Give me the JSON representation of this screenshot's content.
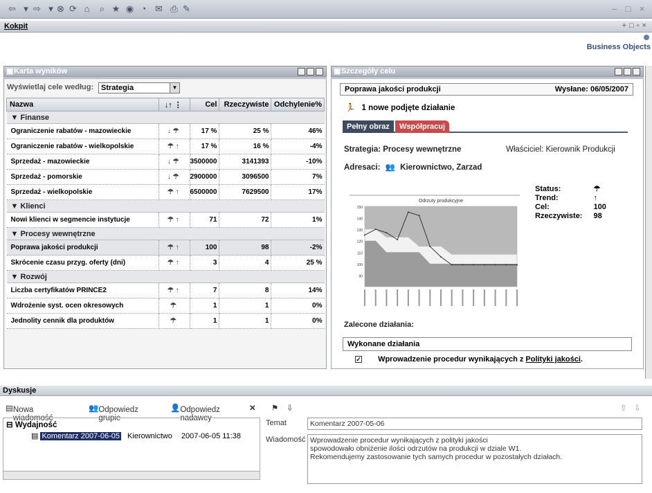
{
  "kokpit": {
    "title": "Kokpit"
  },
  "logo": {
    "text": "Business Objects"
  },
  "left_panel": {
    "title": "Karta wyników",
    "filter_label": "Wyświetlaj cele według:",
    "filter_value": "Strategia",
    "columns": {
      "name": "Nazwa",
      "cel": "Cel",
      "rzecz": "Rzeczywiste",
      "odch": "Odchylenie%"
    },
    "groups": [
      {
        "name": "Finanse",
        "rows": [
          {
            "name": "Ograniczenie rabatów - mazowieckie",
            "icons": "↓ ☂",
            "cel": "17 %",
            "rzecz": "25 %",
            "odch": "46%"
          },
          {
            "name": "Ograniczenie rabatów - wielkopolskie",
            "icons": "☂ ↑",
            "cel": "17 %",
            "rzecz": "16 %",
            "odch": "-4%"
          },
          {
            "name": "Sprzedaż - mazowieckie",
            "icons": "↓ ☂",
            "cel": "3500000",
            "rzecz": "3141393",
            "odch": "-10%"
          },
          {
            "name": "Sprzedaż - pomorskie",
            "icons": "↓ ☂",
            "cel": "2900000",
            "rzecz": "3096500",
            "odch": "7%"
          },
          {
            "name": "Sprzedaż - wielkopolskie",
            "icons": "☂ ↑",
            "cel": "6500000",
            "rzecz": "7629500",
            "odch": "17%"
          }
        ]
      },
      {
        "name": "Klienci",
        "rows": [
          {
            "name": "Nowi klienci w segmencie instytucje",
            "icons": "☂ ↑",
            "cel": "71",
            "rzecz": "72",
            "odch": "1%"
          }
        ]
      },
      {
        "name": "Procesy wewnętrzne",
        "rows": [
          {
            "name": "Poprawa jakości produkcji",
            "icons": "☂ ↑",
            "cel": "100",
            "rzecz": "98",
            "odch": "-2%"
          },
          {
            "name": "Skrócenie czasu przyg. oferty (dni)",
            "icons": "☂ ↑",
            "cel": "3",
            "rzecz": "4",
            "odch": "25 %"
          }
        ]
      },
      {
        "name": "Rozwój",
        "rows": [
          {
            "name": "Liczba certyfikatów PRINCE2",
            "icons": "☂ ↑",
            "cel": "7",
            "rzecz": "8",
            "odch": "14%"
          },
          {
            "name": "Wdrożenie syst. ocen okresowych",
            "icons": "☂",
            "cel": "1",
            "rzecz": "1",
            "odch": "0%"
          },
          {
            "name": "Jednolity cennik dla produktów",
            "icons": "☂",
            "cel": "1",
            "rzecz": "1",
            "odch": "0%"
          }
        ]
      }
    ]
  },
  "right_panel": {
    "title": "Szczegóły celu",
    "goal": "Poprawa jakości produkcji",
    "sent": "Wysłane: 06/05/2007",
    "new_action": "1 nowe podjęte działanie",
    "tab_full": "Pełny obraz",
    "tab_collab": "Współpracuj",
    "strategy": "Strategia: Procesy wewnętrzne",
    "owner": "Właściciel: Kierownik Produkcji",
    "addressees_label": "Adresaci:",
    "addressees": "Kierownictwo, Zarzad",
    "status_label": "Status:",
    "trend_label": "Trend:",
    "trend_value": "↑",
    "cel_label": "Cel:",
    "cel_value": "100",
    "rzecz_label": "Rzeczywiste:",
    "rzecz_value": "98",
    "recommended": "Zalecone działania:",
    "done": "Wykonane działania",
    "done_item_pre": "Wprowadzenie procedur wynikających z ",
    "done_item_link": "Polityki jakości",
    "done_item_post": "."
  },
  "chart_data": {
    "type": "line",
    "title": "Odrzuty produkcyjne",
    "ylim": [
      80,
      150
    ],
    "yticks": [
      "150",
      "140",
      "130",
      "120",
      "110",
      "100",
      "90"
    ],
    "series": [
      {
        "values": [
          125,
          130,
          127,
          121,
          145,
          142,
          115,
          106,
          99,
          99,
          99,
          99,
          99,
          99,
          99
        ]
      }
    ]
  },
  "discussion": {
    "title": "Dyskusje",
    "new_msg": "Nowa wiadomość",
    "reply_group": "Odpowiedz grupie",
    "reply_sender": "Odpowiedz nadawcy",
    "tree_root": "Wydajność",
    "tree_item": "Komentarz 2007-06-05",
    "tree_author": "Kierownictwo",
    "tree_date": "2007-06-05 11:38",
    "subject_label": "Temat",
    "subject_value": "Komentarz 2007-05-06",
    "message_label": "Wiadomość",
    "message_lines": [
      "Wprowadzenie procedur wynikających z polityki jakości",
      "spowodowało obniżenie ilości odrzutów na produkcji w dziale W1.",
      "Rekomendujemy zastosowanie tych samych procedur w pozostałych działach."
    ]
  }
}
